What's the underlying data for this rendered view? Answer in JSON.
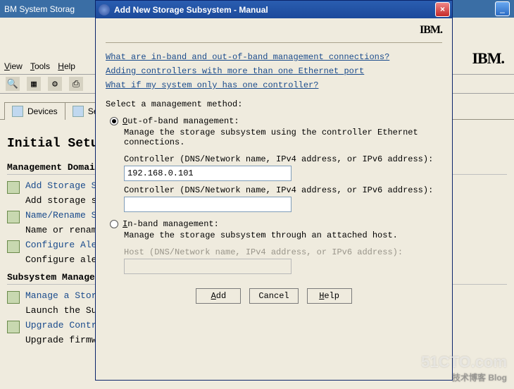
{
  "bg": {
    "title": "BM System Storag",
    "logo": "IBM.",
    "menu": {
      "view": "View",
      "tools": "Tools",
      "help": "Help"
    },
    "tabs": {
      "devices": "Devices",
      "settings": "Set"
    },
    "h1": "Initial Setup",
    "sectionA": "Management Domain",
    "taskA1": {
      "title": "Add Storage Subsy",
      "sub": "Add storage subsy"
    },
    "taskA2": {
      "title": "Name/Rename Stora",
      "sub": "Name or rename st"
    },
    "taskA3": {
      "title": "Configure Alerts",
      "sub": "Configure alerts "
    },
    "sectionB": "Subsystem Managem",
    "taskB1": {
      "title": "Manage a Storage S",
      "sub": "Launch the Subsyst"
    },
    "taskB2": {
      "title": "Upgrade Controller",
      "sub": "Upgrade firmware on multiple storage subsystems concurrently."
    }
  },
  "dialog": {
    "title": "Add New Storage Subsystem - Manual",
    "logo": "IBM.",
    "links": {
      "l1": "What are in-band and out-of-band management connections?",
      "l2": "Adding controllers with more than one Ethernet port",
      "l3": "What if my system only has one controller?"
    },
    "select_label": "Select a management method:",
    "oob": {
      "label": "Out-of-band management:",
      "desc": "Manage the storage subsystem using the controller Ethernet connections.",
      "ctrl1_label": "Controller (DNS/Network name, IPv4 address, or IPv6 address):",
      "ctrl1_value": "192.168.0.101",
      "ctrl2_label": "Controller (DNS/Network name, IPv4 address, or IPv6 address):",
      "ctrl2_value": ""
    },
    "ib": {
      "label": "In-band management:",
      "desc": "Manage the storage subsystem through an attached host.",
      "host_label": "Host (DNS/Network name, IPv4 address, or IPv6 address):"
    },
    "buttons": {
      "add": "Add",
      "cancel": "Cancel",
      "help": "Help"
    }
  },
  "watermark": {
    "main": "51CTO.com",
    "sub": "技术博客   Blog"
  }
}
